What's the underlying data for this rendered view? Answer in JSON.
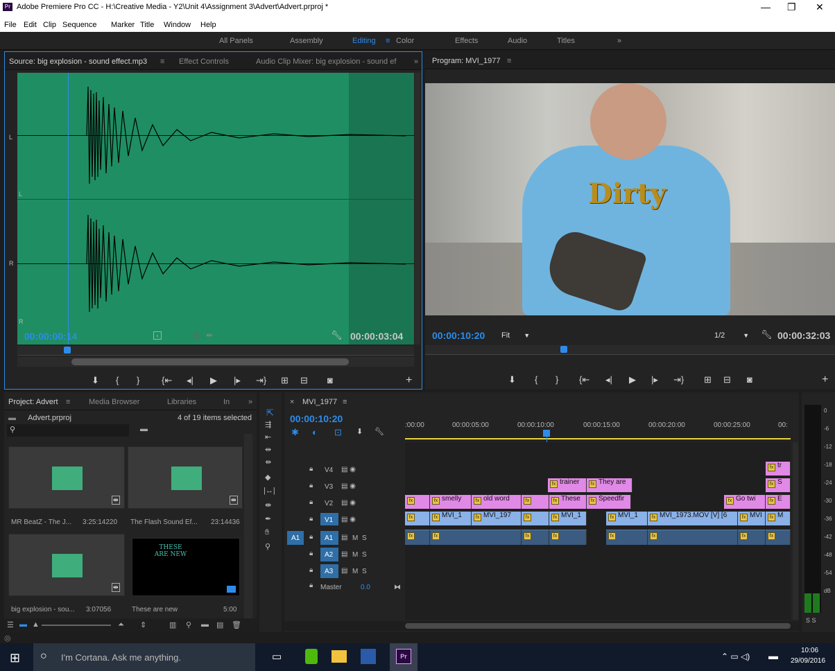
{
  "window": {
    "title": "Adobe Premiere Pro CC - H:\\Creative Media - Y2\\Unit 4\\Assignment 3\\Advert\\Advert.prproj *",
    "app_badge": "Pr"
  },
  "menu": [
    "File",
    "Edit",
    "Clip",
    "Sequence",
    "Marker",
    "Title",
    "Window",
    "Help"
  ],
  "workspaces": [
    "All Panels",
    "Assembly",
    "Editing",
    "Color",
    "Effects",
    "Audio",
    "Titles"
  ],
  "workspace_active": "Editing",
  "workspace_menu_glyph": "≡",
  "workspace_overflow": "»",
  "source": {
    "tabs": [
      "Source: big explosion - sound effect.mp3",
      "Effect Controls",
      "Audio Clip Mixer: big explosion - sound ef"
    ],
    "tab_menu": "≡",
    "overflow": "»",
    "channel_l": "L",
    "channel_r": "R",
    "timecode_in": "00:00:00:14",
    "timecode_duration": "00:00:03:04",
    "waveform_color": "#1f8e63",
    "playhead_color": "#2d8ceb"
  },
  "program": {
    "tab": "Program: MVI_1977",
    "tab_menu": "≡",
    "overlay_text": "Dirty",
    "timecode_in": "00:00:10:20",
    "fit": "Fit",
    "resolution": "1/2",
    "timecode_duration": "00:00:32:03"
  },
  "project": {
    "tabs": [
      "Project: Advert",
      "Media Browser",
      "Libraries",
      "In"
    ],
    "tab_menu": "≡",
    "overflow": "»",
    "file": "Advert.prproj",
    "selection": "4 of 19 items selected",
    "items": [
      {
        "name": "MR BeatZ - The J...",
        "duration": "3:25:14220",
        "kind": "audio"
      },
      {
        "name": "The Flash Sound Ef...",
        "duration": "23:14436",
        "kind": "audio"
      },
      {
        "name": "big explosion - sou...",
        "duration": "3:07056",
        "kind": "audio"
      },
      {
        "name": "These are new",
        "duration": "5:00",
        "kind": "title",
        "preview": "THESE ARE NEW"
      }
    ]
  },
  "timeline": {
    "tab": "MVI_1977",
    "tab_close": "×",
    "tab_menu": "≡",
    "timecode": "00:00:10:20",
    "ruler": [
      ":00:00",
      "00:00:05:00",
      "00:00:10:00",
      "00:00:15:00",
      "00:00:20:00",
      "00:00:25:00",
      "00:"
    ],
    "video_tracks": [
      "V4",
      "V3",
      "V2",
      "V1"
    ],
    "audio_tracks": [
      "A1",
      "A2",
      "A3"
    ],
    "master": "Master",
    "master_value": "0.0",
    "source_patch": "A1",
    "mute": "M",
    "solo": "S",
    "clips_v3": [
      "trainer",
      "They are"
    ],
    "clips_v2": [
      "",
      "smelly",
      "old word",
      "",
      "These",
      "Speedfir",
      "Go twi",
      "E"
    ],
    "clips_v1": [
      "",
      "MVI_1",
      "MVI_197",
      "",
      "MVI_1",
      "MVI_1",
      "MVI_1973.MOV [V] [6",
      "MVI",
      "M"
    ],
    "clips_v4": [
      "tr"
    ],
    "clips_v3b": [
      "S"
    ]
  },
  "meter": {
    "scale": [
      "0",
      "-6",
      "-12",
      "-18",
      "-24",
      "-30",
      "-36",
      "-42",
      "-48",
      "-54",
      "dB"
    ],
    "solo": "S S"
  },
  "taskbar": {
    "search": "I'm Cortana. Ask me anything.",
    "time": "10:06",
    "date": "29/09/2016"
  }
}
